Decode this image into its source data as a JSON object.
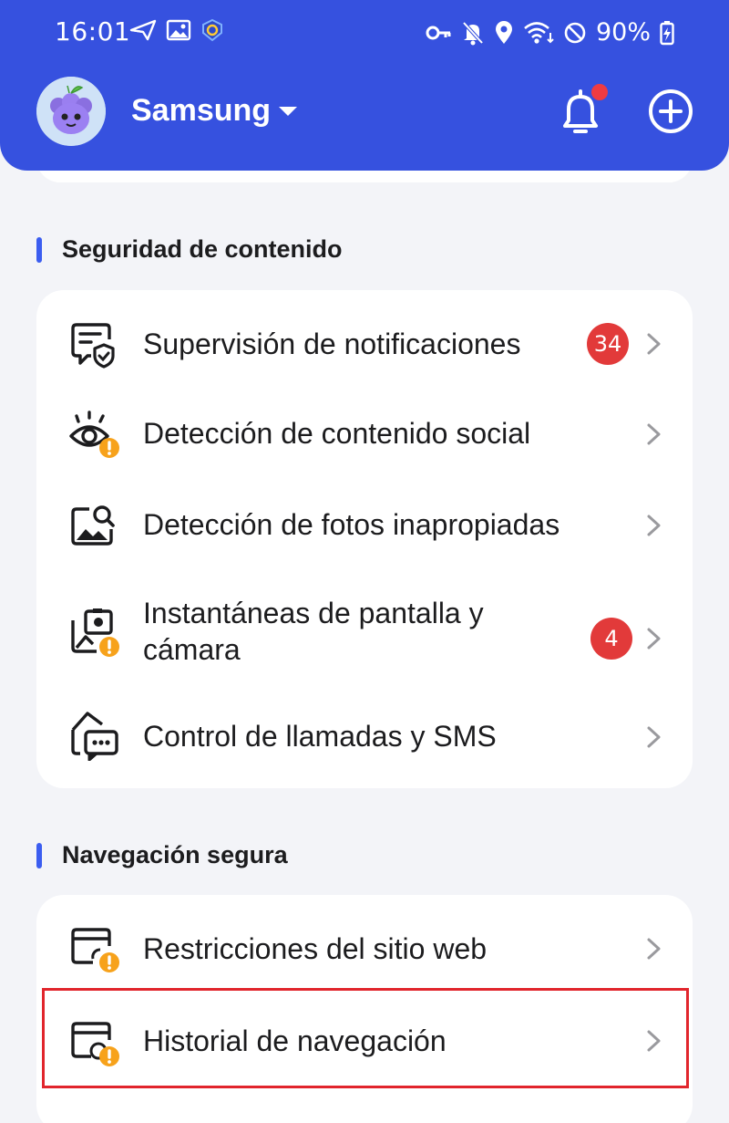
{
  "status_bar": {
    "time": "16:01",
    "battery": "90%"
  },
  "header": {
    "profile_name": "Samsung",
    "notification_dot_color": "#ef3b42",
    "background_color": "#3651df"
  },
  "sections": [
    {
      "title": "Seguridad de contenido",
      "items": [
        {
          "label": "Supervisión de notificaciones",
          "badge": "34",
          "icon": "notification-shield-icon"
        },
        {
          "label": "Detección de contenido social",
          "badge": "",
          "icon": "eye-warning-icon"
        },
        {
          "label": "Detección de fotos inapropiadas",
          "badge": "",
          "icon": "image-search-icon"
        },
        {
          "label_line1": "Instantáneas de pantalla y",
          "label_line2": "cámara",
          "badge": "4",
          "icon": "screenshot-warning-icon"
        },
        {
          "label": "Control de llamadas y SMS",
          "badge": "",
          "icon": "call-sms-icon"
        }
      ]
    },
    {
      "title": "Navegación segura",
      "items": [
        {
          "label": "Restricciones del sitio web",
          "icon": "browser-restriction-icon"
        },
        {
          "label": "Historial de navegación",
          "icon": "browser-history-icon"
        }
      ]
    }
  ]
}
